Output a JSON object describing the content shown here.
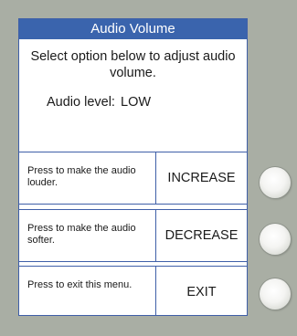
{
  "title": "Audio Volume",
  "instruction": "Select option below to adjust audio volume.",
  "level": {
    "label": "Audio level:",
    "value": "LOW"
  },
  "options": [
    {
      "description": "Press to make the audio louder.",
      "action": "INCREASE"
    },
    {
      "description": "Press to make the audio softer.",
      "action": "DECREASE"
    },
    {
      "description": "Press to exit this menu.",
      "action": "EXIT"
    }
  ],
  "colors": {
    "title_bar": "#3a64ad",
    "border": "#3f5fa8",
    "panel": "#a9aea4"
  }
}
